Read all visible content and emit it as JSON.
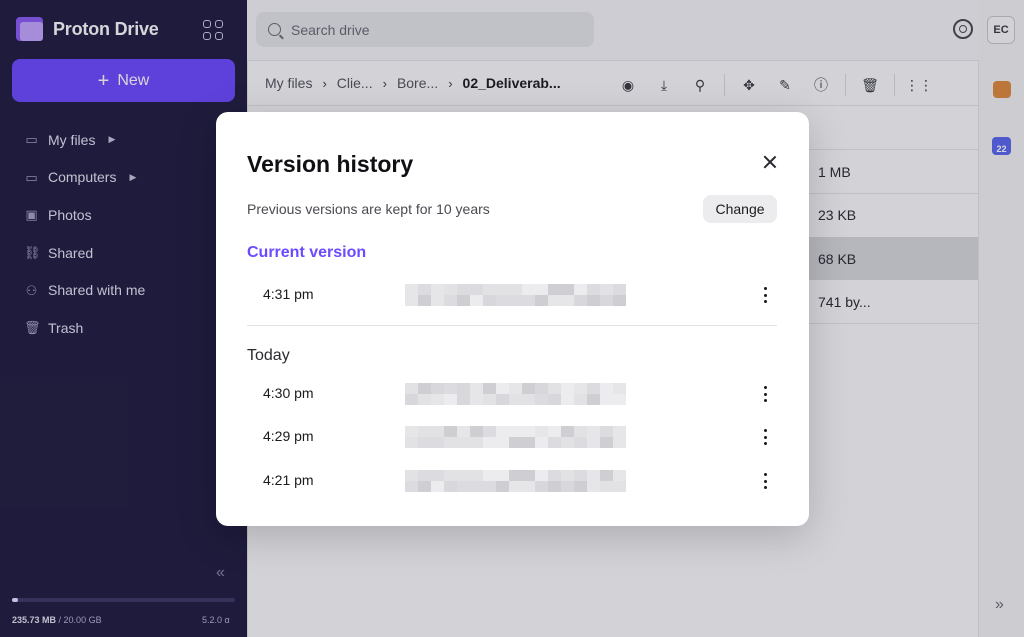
{
  "app": {
    "name": "Proton Drive"
  },
  "sidebar": {
    "new_label": "New",
    "items": [
      {
        "label": "My files",
        "icon": "hdd-icon",
        "has_arrow": true
      },
      {
        "label": "Computers",
        "icon": "computer-icon",
        "has_arrow": true
      },
      {
        "label": "Photos",
        "icon": "image-icon",
        "has_arrow": false
      },
      {
        "label": "Shared",
        "icon": "link-icon",
        "has_arrow": false
      },
      {
        "label": "Shared with me",
        "icon": "users-icon",
        "has_arrow": false
      },
      {
        "label": "Trash",
        "icon": "trash-icon",
        "has_arrow": false
      }
    ],
    "storage": {
      "used": "235.73 MB",
      "separator": " / ",
      "total": "20.00 GB",
      "fill_fraction": 0.012
    },
    "version": "5.2.0 α"
  },
  "header": {
    "search_placeholder": "Search drive",
    "avatar_initials": "EC"
  },
  "breadcrumb": {
    "items": [
      "My files",
      "Clie...",
      "Bore..."
    ],
    "current": "02_Deliverab..."
  },
  "toolbar": [
    "preview-icon",
    "download-icon",
    "share-icon",
    "move-icon",
    "rename-icon",
    "details-icon",
    "trash-icon",
    "more-icon"
  ],
  "file_sizes": [
    "1 MB",
    "23 KB",
    "68 KB",
    "741 by..."
  ],
  "rail": {
    "calendar_day": "22"
  },
  "modal": {
    "title": "Version history",
    "retention_text": "Previous versions are kept for 10 years",
    "change_label": "Change",
    "current_section": "Current version",
    "current_time": "4:31 pm",
    "today_section": "Today",
    "today_times": [
      "4:30 pm",
      "4:29 pm",
      "4:21 pm"
    ]
  },
  "colors": {
    "brand": "#6d4aff",
    "sidebar_bg": "#1f1c3f"
  }
}
